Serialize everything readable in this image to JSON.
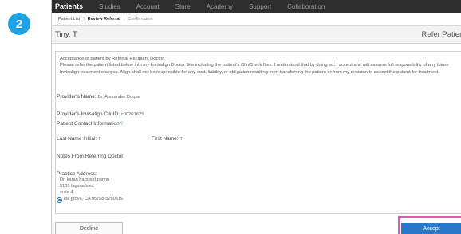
{
  "step_number": "2",
  "nav": {
    "items": [
      "Patients",
      "Studies",
      "Account",
      "Store",
      "Academy",
      "Support",
      "Collaboration"
    ],
    "active_index": 0
  },
  "breadcrumb": {
    "items": [
      "Patient List",
      "Review Referral",
      "Confirmation"
    ]
  },
  "header": {
    "patient_name": "Tiny, T",
    "page_title": "Refer Patient"
  },
  "main": {
    "intro_title": "Acceptance of patient by Referral Recipient Doctor.",
    "intro_body": "Please refer the patient listed below into my Invisalign Doctor Site including the patient's ClinCheck files. I understand that by doing so, I accept and will assume full responsibility of any future Invisalign treatment charges. Align shall not be responsible for any cost, liability, or obligation resulting from transferring the patient or from my decision to accept the patient for treatment.",
    "provider_name_label": "Provider's Name:",
    "provider_name_value": "Dr. Alexander Duque",
    "clinid_label": "Provider's Invisalign ClinID:",
    "clinid_value": "c00201625",
    "contact_info_label": "Patient Contact Information",
    "last_name_label": "Last Name Initial:",
    "last_name_value": "T",
    "first_name_label": "First Name:",
    "first_name_value": "T",
    "notes_label": "Notes From Referring Doctor:",
    "practice_address_label": "Practice Address:",
    "address_lines": [
      "Dr. karan harpreet pannu",
      "5105 laguna blvd",
      "suite 4"
    ],
    "address_selected_line": "elk grove, CA  95758-5260  US"
  },
  "footer": {
    "decline_label": "Decline",
    "accept_label": "Accept"
  },
  "colors": {
    "badge": "#1ea3e6",
    "nav_background": "#2e2e2e",
    "accept_button": "#2a78c8",
    "highlight": "#e05aa6"
  }
}
